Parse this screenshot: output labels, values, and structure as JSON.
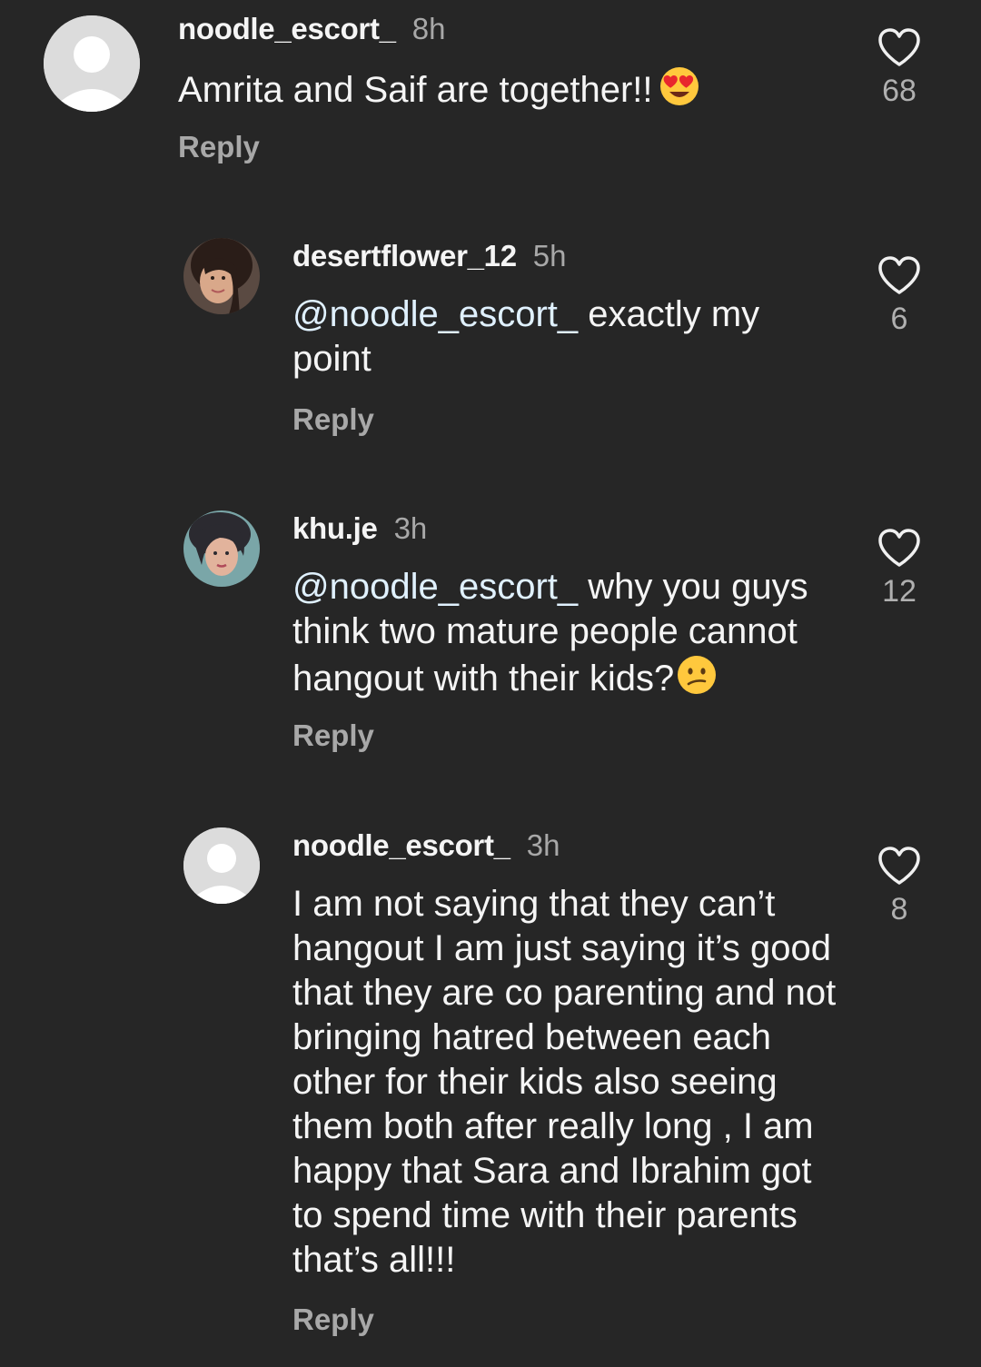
{
  "comments": [
    {
      "username": "noodle_escort_",
      "time": "8h",
      "mention": "",
      "text": "Amrita and Saif are together!!",
      "emoji": "heart-eyes-emoji",
      "reply_label": "Reply",
      "likes": "68",
      "avatar": "default-avatar-icon"
    },
    {
      "username": "desertflower_12",
      "time": "5h",
      "mention": "@noodle_escort_",
      "text": " exactly my point",
      "emoji": "",
      "reply_label": "Reply",
      "likes": "6",
      "avatar": "profile-photo"
    },
    {
      "username": "khu.je",
      "time": "3h",
      "mention": "@noodle_escort_",
      "text": " why you guys think two mature people cannot hangout with their kids?",
      "emoji": "confused-face-emoji",
      "reply_label": "Reply",
      "likes": "12",
      "avatar": "profile-photo"
    },
    {
      "username": "noodle_escort_",
      "time": "3h",
      "mention": "",
      "text": "I am not saying that they can’t hangout I am just saying it’s good that they are co parenting and not bringing hatred between each other for their kids also seeing them both after really long , I am  happy that Sara and Ibrahim got to spend time with their parents that’s all!!!",
      "emoji": "",
      "reply_label": "Reply",
      "likes": "8",
      "avatar": "default-avatar-icon"
    }
  ],
  "colors": {
    "background": "#262626",
    "text": "#f5f5f5",
    "secondary": "#a8a8a8",
    "mention": "#e0f1ff"
  }
}
